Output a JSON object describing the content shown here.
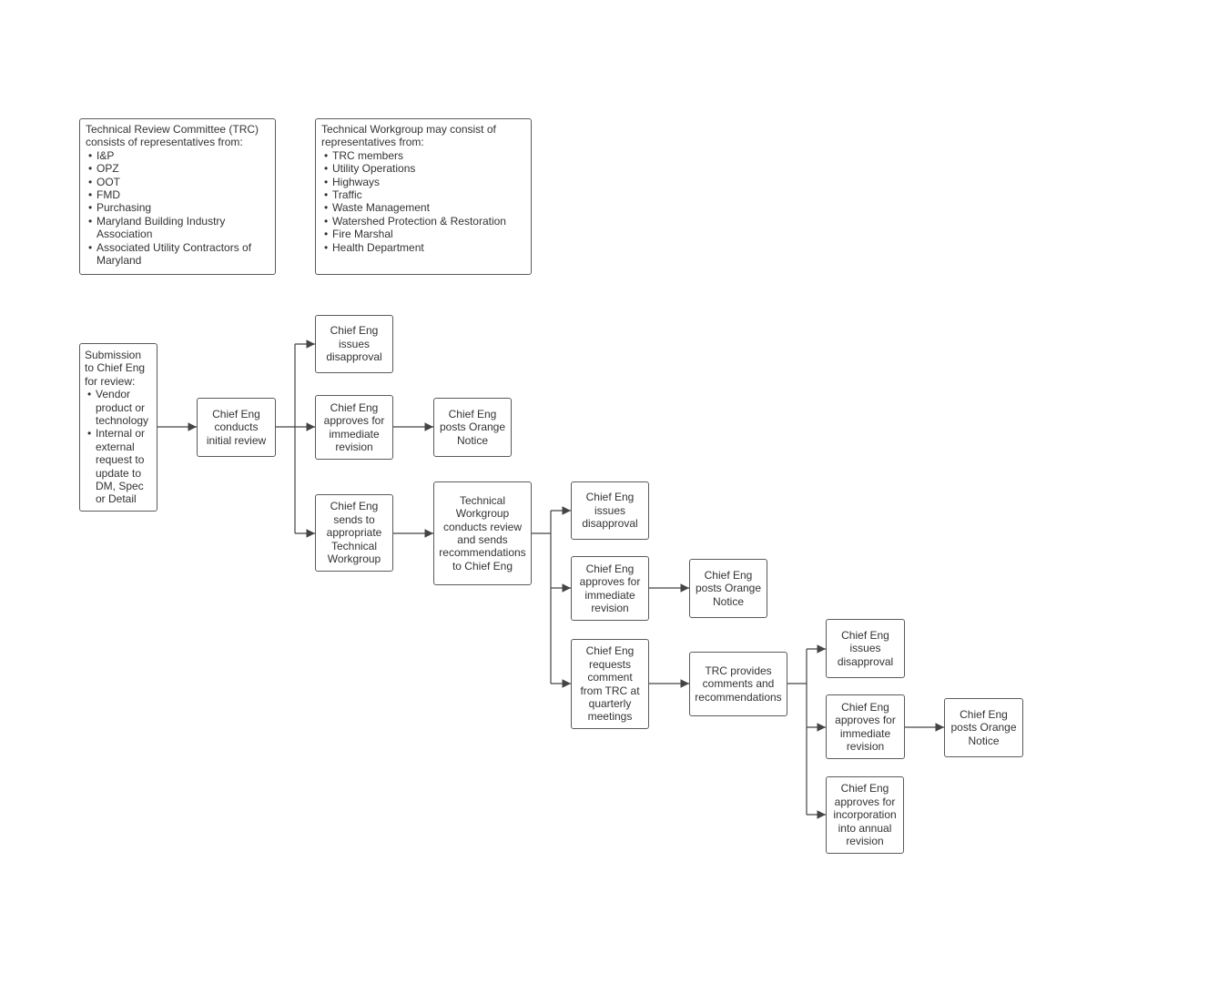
{
  "trc_note": {
    "heading": "Technical Review Committee (TRC) consists of representatives from:",
    "items": [
      "I&P",
      "OPZ",
      "OOT",
      "FMD",
      "Purchasing",
      "Maryland Building Industry Association",
      "Associated Utility Contractors of Maryland"
    ]
  },
  "workgroup_note": {
    "heading": "Technical Workgroup may consist of representatives from:",
    "items": [
      "TRC members",
      "Utility Operations",
      "Highways",
      "Traffic",
      "Waste Management",
      "Watershed Protection & Restoration",
      "Fire Marshal",
      "Health Department"
    ]
  },
  "submission": {
    "heading": "Submission to Chief Eng for review:",
    "items": [
      "Vendor product or technology",
      "Internal or external request to update to DM, Spec or Detail"
    ]
  },
  "nodes": {
    "initial_review": "Chief Eng conducts initial review",
    "disapproval_1": "Chief Eng issues disapproval",
    "approve_1": "Chief Eng approves for immediate revision",
    "orange_1": "Chief Eng posts Orange Notice",
    "send_workgroup": "Chief Eng sends to appropriate Technical Workgroup",
    "workgroup_review": "Technical Workgroup conducts review and sends recommendations to Chief Eng",
    "disapproval_2": "Chief Eng issues disapproval",
    "approve_2": "Chief Eng approves for immediate revision",
    "orange_2": "Chief Eng posts Orange Notice",
    "request_trc": "Chief Eng requests comment from TRC at quarterly meetings",
    "trc_comments": "TRC provides comments and recommendations",
    "disapproval_3": "Chief Eng issues disapproval",
    "approve_3": "Chief Eng approves for immediate revision",
    "orange_3": "Chief Eng posts Orange Notice",
    "annual_revision": "Chief Eng approves for incorporation into annual revision"
  }
}
